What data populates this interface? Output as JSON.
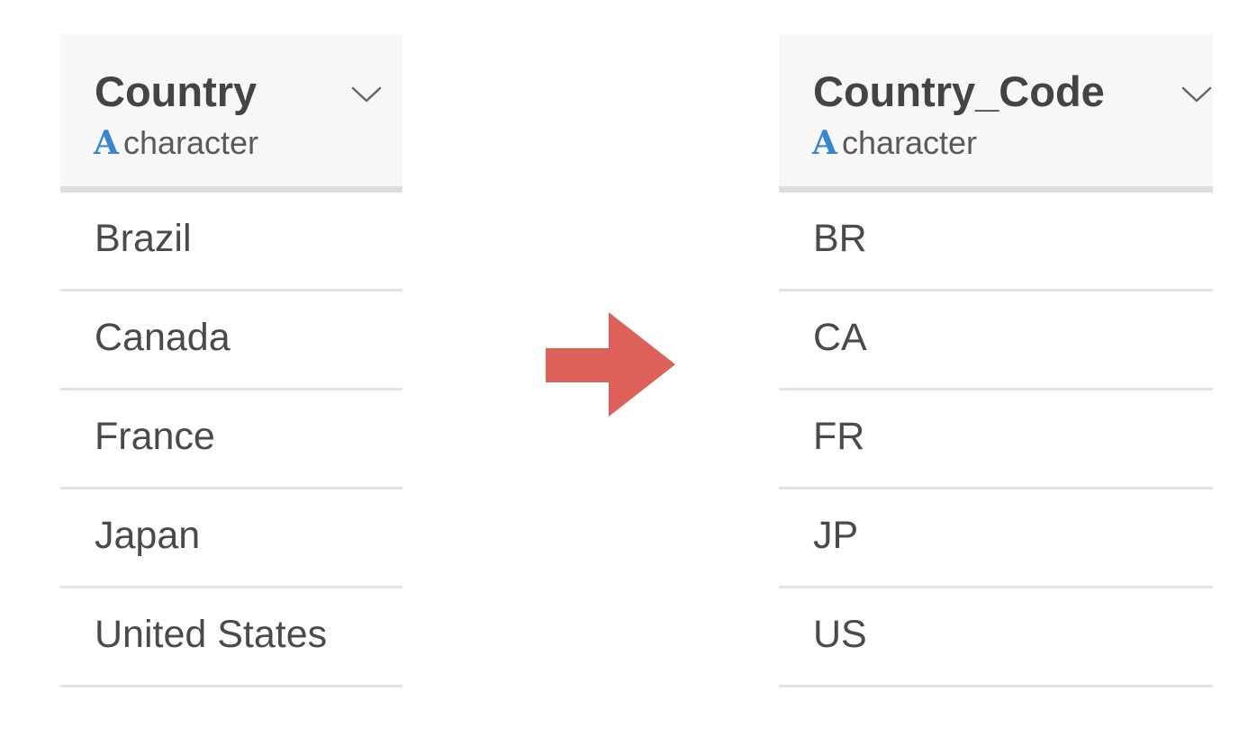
{
  "left_column": {
    "name": "Country",
    "type_icon": "A",
    "type_label": "character",
    "rows": [
      "Brazil",
      "Canada",
      "France",
      "Japan",
      "United States"
    ]
  },
  "right_column": {
    "name": "Country_Code",
    "type_icon": "A",
    "type_label": "character",
    "rows": [
      "BR",
      "CA",
      "FR",
      "JP",
      "US"
    ]
  },
  "icons": {
    "column_menu": "chevron-down-icon",
    "transform_arrow": "arrow-right-icon"
  },
  "colors": {
    "type_icon": "#3a85d0",
    "arrow": "#dd6159"
  }
}
